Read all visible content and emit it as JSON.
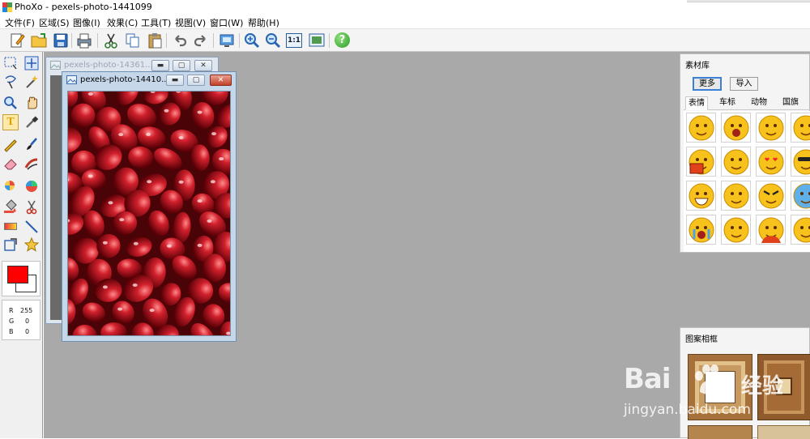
{
  "app": {
    "title": "PhoXo - pexels-photo-1441099"
  },
  "menu": {
    "items": [
      "文件(F)",
      "区域(S)",
      "图像(I)",
      "效果(C)",
      "工具(T)",
      "视图(V)",
      "窗口(W)",
      "帮助(H)"
    ]
  },
  "toolbar": {
    "icons": [
      "new-file-icon",
      "open-folder-icon",
      "save-icon",
      "print-icon",
      "cut-icon",
      "copy-icon",
      "paste-icon",
      "undo-icon",
      "redo-icon",
      "screen-capture-icon",
      "zoom-in-icon",
      "zoom-out-icon",
      "actual-size-icon",
      "fit-window-icon",
      "help-icon"
    ],
    "actual_size_label": "1:1",
    "help_label": "?"
  },
  "toolbox": {
    "tools": [
      "rect-select-icon",
      "move-icon",
      "lasso-icon",
      "magic-wand-icon",
      "zoom-tool-icon",
      "hand-icon",
      "text-tool-icon",
      "eyedropper-icon",
      "pencil-icon",
      "brush-icon",
      "eraser-icon",
      "smudge-icon",
      "clone-stamp-icon",
      "color-replace-icon",
      "paint-bucket-icon",
      "scissors-icon",
      "gradient-icon",
      "line-icon",
      "transform-icon",
      "shape-star-icon"
    ],
    "selected_tool": "text-tool-icon",
    "text_tool_label": "T",
    "foreground_color": "#ff0000",
    "background_color": "#ffffff",
    "rgb": [
      {
        "channel": "R",
        "value": "255"
      },
      {
        "channel": "G",
        "value": "0"
      },
      {
        "channel": "B",
        "value": "0"
      }
    ]
  },
  "windows": {
    "back": {
      "title": "pexels-photo-14361..."
    },
    "front": {
      "title": "pexels-photo-14410..."
    },
    "controls": {
      "minimize": "▬",
      "maximize": "▢",
      "close": "✕"
    }
  },
  "material_panel": {
    "title": "素材库",
    "buttons": [
      "更多",
      "导入"
    ],
    "tabs": [
      "表情",
      "车标",
      "动物",
      "国旗"
    ],
    "active_tab": "表情",
    "items": [
      "emoji-crying-icon",
      "emoji-shouting-icon",
      "emoji-sleepy-icon",
      "emoji-sick-icon",
      "emoji-reading-icon",
      "emoji-confused-icon",
      "emoji-love-icon",
      "emoji-cool-icon",
      "emoji-grin-icon",
      "emoji-smirk-icon",
      "emoji-angry-icon",
      "emoji-cold-icon",
      "emoji-tears-icon",
      "emoji-annoyed-icon",
      "emoji-fire-icon",
      "emoji-dizzy-icon"
    ]
  },
  "frame_panel": {
    "title": "图案相框"
  },
  "watermark": {
    "brand": "Bai",
    "brand_cn": "经验",
    "url": "jingyan.baidu.com"
  },
  "colors": {
    "workspace": "#a9a9a9",
    "accent": "#3c7fd6",
    "selection": "#fde9a8"
  }
}
